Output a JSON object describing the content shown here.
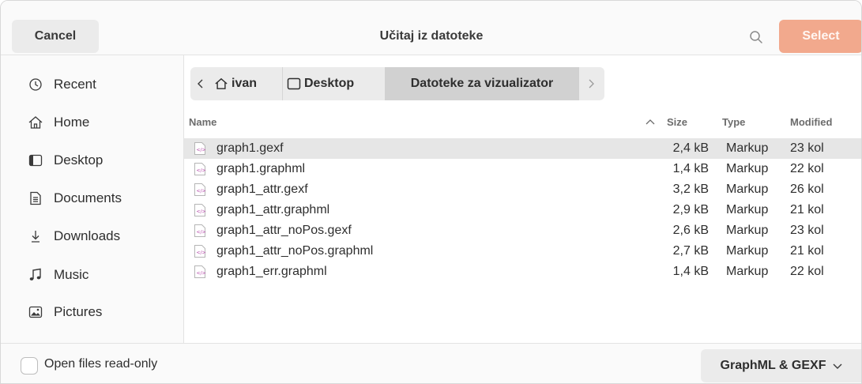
{
  "header": {
    "cancel_label": "Cancel",
    "title": "Učitaj iz datoteke",
    "select_label": "Select",
    "accent": "#f2a98d"
  },
  "sidebar": {
    "items": [
      {
        "label": "Recent",
        "icon": "clock-icon"
      },
      {
        "label": "Home",
        "icon": "home-icon"
      },
      {
        "label": "Desktop",
        "icon": "desktop-icon"
      },
      {
        "label": "Documents",
        "icon": "document-icon"
      },
      {
        "label": "Downloads",
        "icon": "download-icon"
      },
      {
        "label": "Music",
        "icon": "music-icon"
      },
      {
        "label": "Pictures",
        "icon": "picture-icon"
      }
    ]
  },
  "breadcrumb": {
    "items": [
      {
        "label": "ivan",
        "icon": "home-icon"
      },
      {
        "label": "Desktop",
        "icon": "desktop-icon"
      },
      {
        "label": "Datoteke za vizualizator"
      }
    ]
  },
  "list": {
    "columns": {
      "name": "Name",
      "size": "Size",
      "type": "Type",
      "modified": "Modified"
    },
    "sort_indicator": "^",
    "rows": [
      {
        "name": "graph1.gexf",
        "size": "2,4 kB",
        "type": "Markup",
        "modified": "23 kol"
      },
      {
        "name": "graph1.graphml",
        "size": "1,4 kB",
        "type": "Markup",
        "modified": "22 kol"
      },
      {
        "name": "graph1_attr.gexf",
        "size": "3,2 kB",
        "type": "Markup",
        "modified": "26 kol"
      },
      {
        "name": "graph1_attr.graphml",
        "size": "2,9 kB",
        "type": "Markup",
        "modified": "21 kol"
      },
      {
        "name": "graph1_attr_noPos.gexf",
        "size": "2,6 kB",
        "type": "Markup",
        "modified": "23 kol"
      },
      {
        "name": "graph1_attr_noPos.graphml",
        "size": "2,7 kB",
        "type": "Markup",
        "modified": "21 kol"
      },
      {
        "name": "graph1_err.graphml",
        "size": "1,4 kB",
        "type": "Markup",
        "modified": "22 kol"
      }
    ]
  },
  "footer": {
    "readonly_label": "Open files read-only",
    "filter_label": "GraphML & GEXF"
  }
}
